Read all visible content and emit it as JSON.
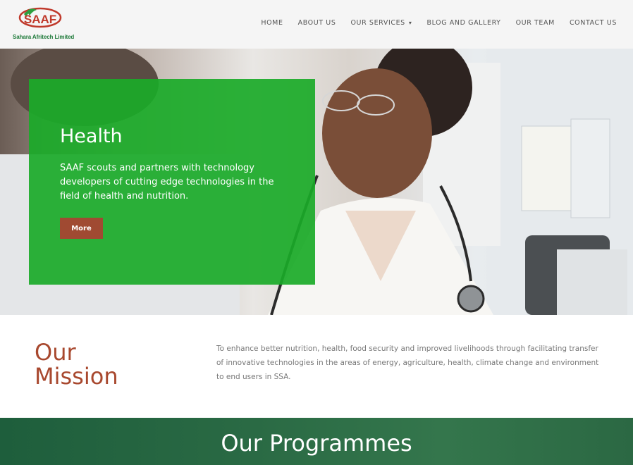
{
  "header": {
    "logo_text": "Sahara Afritech Limited",
    "logo_mark": "SAAF",
    "nav": [
      {
        "label": "HOME"
      },
      {
        "label": "ABOUT US"
      },
      {
        "label": "OUR SERVICES",
        "icon": "chevron-down-icon"
      },
      {
        "label": "BLOG AND GALLERY"
      },
      {
        "label": "OUR TEAM"
      },
      {
        "label": "CONTACT US"
      }
    ]
  },
  "hero": {
    "title": "Health",
    "text": "SAAF scouts and partners with technology developers of cutting edge technologies in the field of health and nutrition.",
    "button_label": "More"
  },
  "mission": {
    "title_line1": "Our",
    "title_line2": "Mission",
    "text": "To enhance better nutrition, health, food security and improved livelihoods through facilitating transfer of innovative technologies in the areas of energy, agriculture, health, climate change and environment to end users in SSA."
  },
  "programmes": {
    "title": "Our Programmes"
  },
  "colors": {
    "green_card": "#1aaa28",
    "accent_brown": "#a04a32",
    "mission_title": "#a8482e",
    "programmes_band": "#2a6a44",
    "logo_green": "#1f7a3a",
    "logo_red": "#c0392b"
  }
}
